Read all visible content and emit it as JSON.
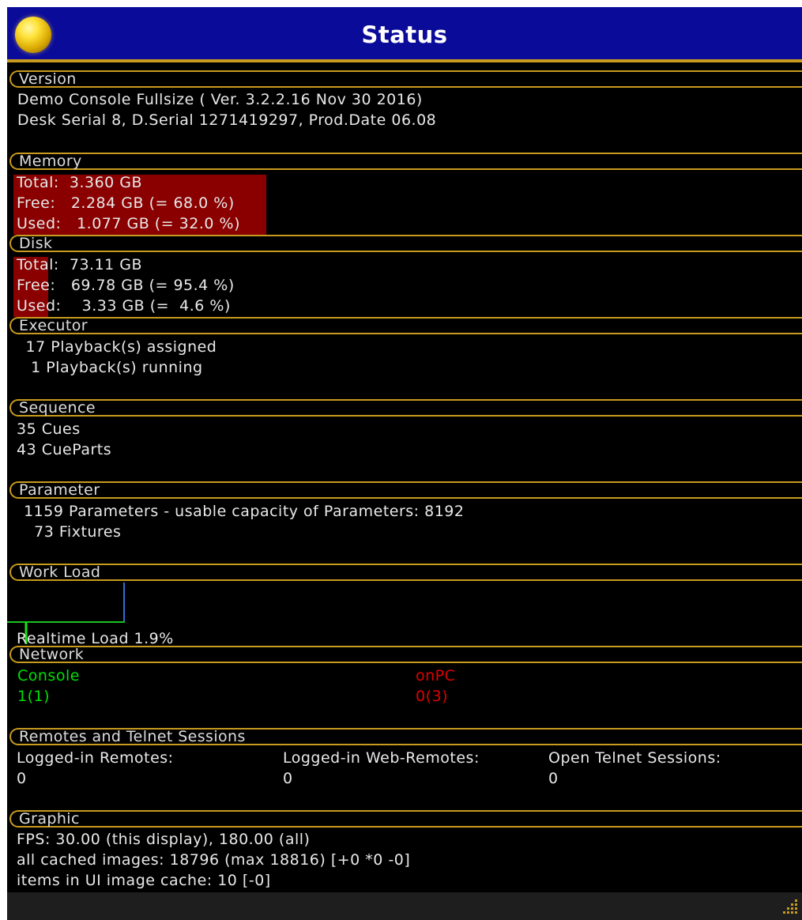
{
  "window": {
    "title": "Status"
  },
  "version": {
    "header": "Version",
    "line1": "Demo Console Fullsize ( Ver. 3.2.2.16 Nov 30 2016)",
    "line2": "Desk Serial 8, D.Serial 1271419297, Prod.Date 06.08"
  },
  "memory": {
    "header": "Memory",
    "total": "Total:  3.360 GB",
    "free": "Free:   2.284 GB (= 68.0 %)",
    "used": "Used:   1.077 GB (= 32.0 %)",
    "used_fraction": 0.32
  },
  "disk": {
    "header": "Disk",
    "total": "Total:  73.11 GB",
    "free": "Free:   69.78 GB (= 95.4 %)",
    "used": "Used:    3.33 GB (=  4.6 %)",
    "used_fraction": 0.046
  },
  "executor": {
    "header": "Executor",
    "line1": " 17 Playback(s) assigned",
    "line2": "  1 Playback(s) running"
  },
  "sequence": {
    "header": "Sequence",
    "line1": "35 Cues",
    "line2": "43 CueParts"
  },
  "parameter": {
    "header": "Parameter",
    "line1": "  1159 Parameters - usable capacity of Parameters: 8192",
    "line2": "    73 Fixtures"
  },
  "workload": {
    "header": "Work Load",
    "realtime": "Realtime Load 1.9%",
    "realtime_fraction": 0.019
  },
  "network": {
    "header": "Network",
    "console_label": "Console",
    "console_value": "1(1)",
    "onpc_label": "onPC",
    "onpc_value": "0(3)",
    "console_color": "#00e000",
    "onpc_color": "#e00000"
  },
  "remotes": {
    "header": "Remotes and Telnet Sessions",
    "col1_label": "Logged-in Remotes:",
    "col1_value": "0",
    "col2_label": "Logged-in Web-Remotes:",
    "col2_value": "0",
    "col3_label": "Open Telnet Sessions:",
    "col3_value": "0"
  },
  "graphic": {
    "header": "Graphic",
    "line1": "FPS: 30.00 (this display), 180.00 (all)",
    "line2": "all cached images: 18796 (max 18816) [+0 *0 -0]",
    "line3": "items in UI image cache: 10 [-0]"
  },
  "colors": {
    "accent": "#c89a1e",
    "title_bg": "#0b0b9a",
    "bar_red": "#8a0000"
  },
  "icons": {
    "title_orb": "yellow-orb-icon",
    "resize": "resize-grip-icon"
  }
}
